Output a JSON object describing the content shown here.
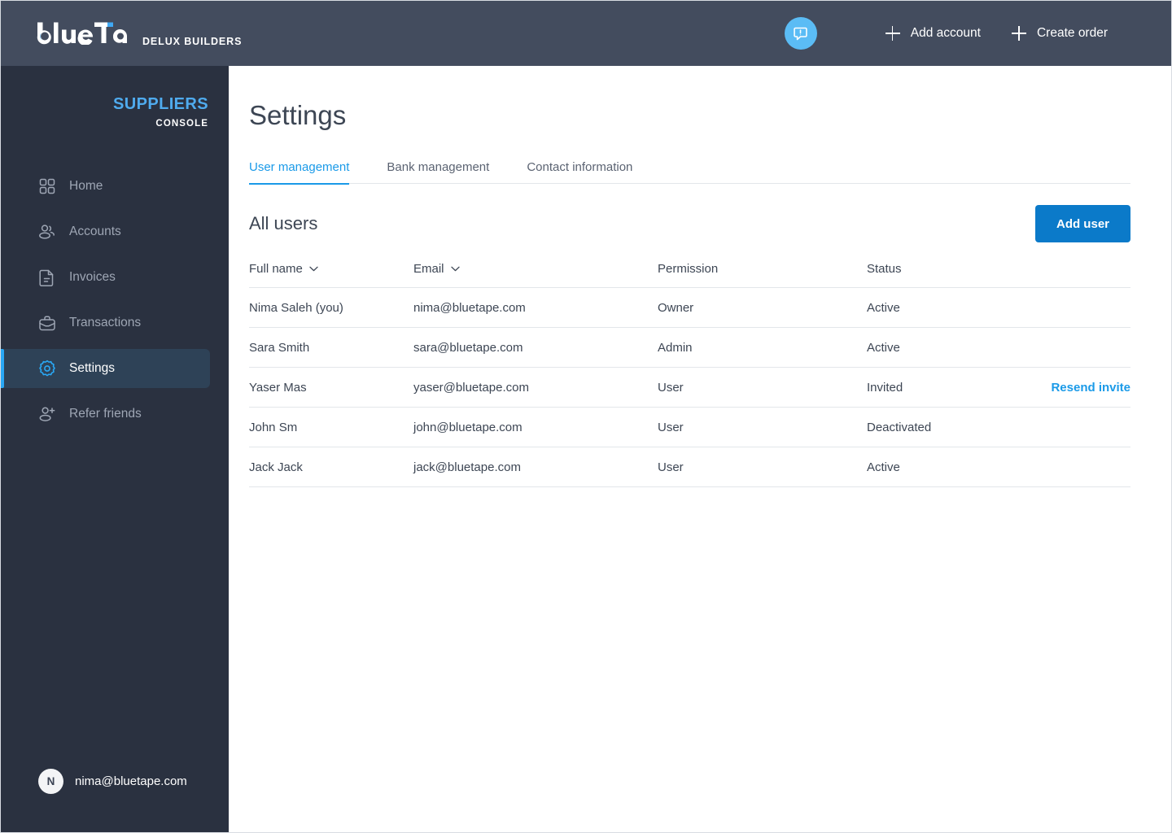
{
  "topbar": {
    "logo_text": "blueTape",
    "company": "DELUX BUILDERS",
    "help_icon": "chat-exclamation-icon",
    "actions": [
      {
        "label": "Add account",
        "icon": "plus-icon"
      },
      {
        "label": "Create order",
        "icon": "plus-icon"
      }
    ]
  },
  "sidebar": {
    "console_title": "SUPPLIERS",
    "console_sub": "CONSOLE",
    "items": [
      {
        "label": "Home",
        "icon": "grid-icon",
        "active": false
      },
      {
        "label": "Accounts",
        "icon": "users-icon",
        "active": false
      },
      {
        "label": "Invoices",
        "icon": "document-icon",
        "active": false
      },
      {
        "label": "Transactions",
        "icon": "briefcase-icon",
        "active": false
      },
      {
        "label": "Settings",
        "icon": "gear-icon",
        "active": true
      },
      {
        "label": "Refer friends",
        "icon": "user-plus-icon",
        "active": false
      }
    ],
    "user": {
      "initial": "N",
      "email": "nima@bluetape.com"
    }
  },
  "main": {
    "page_title": "Settings",
    "tabs": [
      {
        "label": "User management",
        "active": true
      },
      {
        "label": "Bank management",
        "active": false
      },
      {
        "label": "Contact information",
        "active": false
      }
    ],
    "section_title": "All users",
    "add_user_label": "Add user",
    "table": {
      "columns": [
        {
          "label": "Full name",
          "sortable": true
        },
        {
          "label": "Email",
          "sortable": true
        },
        {
          "label": "Permission",
          "sortable": false
        },
        {
          "label": "Status",
          "sortable": false
        },
        {
          "label": "",
          "sortable": false
        }
      ],
      "rows": [
        {
          "name": "Nima Saleh (you)",
          "email": "nima@bluetape.com",
          "permission": "Owner",
          "status": "Active",
          "action": ""
        },
        {
          "name": "Sara Smith",
          "email": "sara@bluetape.com",
          "permission": "Admin",
          "status": "Active",
          "action": ""
        },
        {
          "name": "Yaser Mas",
          "email": "yaser@bluetape.com",
          "permission": "User",
          "status": "Invited",
          "action": "Resend invite"
        },
        {
          "name": "John Sm",
          "email": "john@bluetape.com",
          "permission": "User",
          "status": "Deactivated",
          "action": ""
        },
        {
          "name": "Jack Jack",
          "email": "jack@bluetape.com",
          "permission": "User",
          "status": "Active",
          "action": ""
        }
      ]
    }
  },
  "colors": {
    "topbar_bg": "#434c5e",
    "sidebar_bg": "#2a3140",
    "accent_blue": "#1a9ae8",
    "button_blue": "#0b7ac9",
    "console_blue": "#4fabee",
    "active_nav_bg": "#2e4257",
    "active_nav_bar": "#29a8f5",
    "help_badge": "#5bbcf5"
  }
}
